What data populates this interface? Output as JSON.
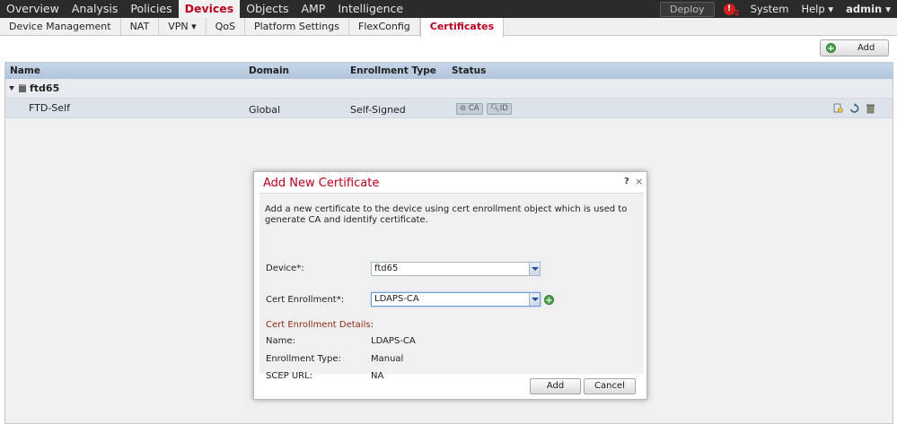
{
  "topnav": {
    "items": [
      "Overview",
      "Analysis",
      "Policies",
      "Devices",
      "Objects",
      "AMP",
      "Intelligence"
    ],
    "deploy": "Deploy",
    "alert_count": "2",
    "system": "System",
    "help": "Help ▾",
    "user": "admin ▾"
  },
  "subnav": {
    "tabs": [
      "Device Management",
      "NAT",
      "VPN ▾",
      "QoS",
      "Platform Settings",
      "FlexConfig",
      "Certificates"
    ]
  },
  "toolbar": {
    "add_label": "Add"
  },
  "table": {
    "headers": [
      "Name",
      "Domain",
      "Enrollment Type",
      "Status"
    ],
    "group": "ftd65",
    "row": {
      "name": "FTD-Self",
      "domain": "Global",
      "enrollment_type": "Self-Signed",
      "status_ca": "CA",
      "status_id": "ID"
    }
  },
  "modal": {
    "title": "Add New Certificate",
    "help": "?",
    "close": "×",
    "description": "Add a new certificate to the device using cert enrollment object which is used to generate CA and identify certificate.",
    "device_label": "Device*:",
    "device_value": "ftd65",
    "cert_label": "Cert Enrollment*:",
    "cert_value": "LDAPS-CA",
    "details_header": "Cert Enrollment Details",
    "details_colon": ":",
    "name_label": "Name:",
    "name_value": "LDAPS-CA",
    "type_label": "Enrollment Type:",
    "type_value": "Manual",
    "scep_label": "SCEP URL:",
    "scep_value": "NA",
    "add_button": "Add",
    "cancel_button": "Cancel"
  },
  "colors": {
    "accent": "#b8001f",
    "nav_bg": "#2b2b2b",
    "table_header": "#b9cbe0"
  }
}
